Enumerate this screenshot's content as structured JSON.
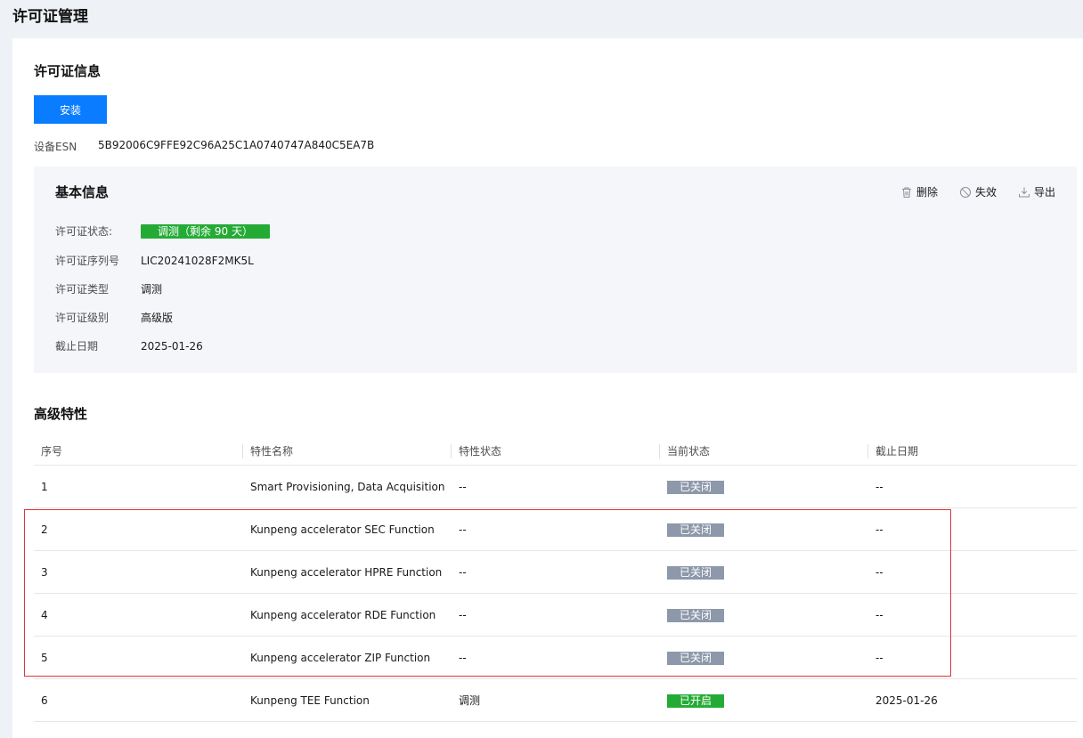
{
  "page_title": "许可证管理",
  "license_info": {
    "title": "许可证信息",
    "install_label": "安装",
    "esn_label": "设备ESN",
    "esn_value": "5B92006C9FFE92C96A25C1A0740747A840C5EA7B"
  },
  "basic": {
    "title": "基本信息",
    "actions": {
      "delete": "删除",
      "invalidate": "失效",
      "export": "导出"
    },
    "status_label": "许可证状态:",
    "status_value": "调测（剩余 90 天）",
    "serial_label": "许可证序列号",
    "serial_value": "LIC20241028F2MK5L",
    "type_label": "许可证类型",
    "type_value": "调测",
    "level_label": "许可证级别",
    "level_value": "高级版",
    "expiry_label": "截止日期",
    "expiry_value": "2025-01-26"
  },
  "features": {
    "title": "高级特性",
    "columns": [
      "序号",
      "特性名称",
      "特性状态",
      "当前状态",
      "截止日期"
    ],
    "rows": [
      {
        "no": "1",
        "name": "Smart Provisioning, Data Acquisition",
        "feature_status": "--",
        "current": "已关闭",
        "expiry": "--"
      },
      {
        "no": "2",
        "name": "Kunpeng accelerator SEC Function",
        "feature_status": "--",
        "current": "已关闭",
        "expiry": "--"
      },
      {
        "no": "3",
        "name": "Kunpeng accelerator HPRE Function",
        "feature_status": "--",
        "current": "已关闭",
        "expiry": "--"
      },
      {
        "no": "4",
        "name": "Kunpeng accelerator RDE Function",
        "feature_status": "--",
        "current": "已关闭",
        "expiry": "--"
      },
      {
        "no": "5",
        "name": "Kunpeng accelerator ZIP Function",
        "feature_status": "--",
        "current": "已关闭",
        "expiry": "--"
      },
      {
        "no": "6",
        "name": "Kunpeng TEE Function",
        "feature_status": "调测",
        "current": "已开启",
        "expiry": "2025-01-26"
      }
    ]
  },
  "colors": {
    "primary": "#0a7cff",
    "success": "#24ab36",
    "disabled": "#8d98aa",
    "highlight": "#d9363e"
  }
}
